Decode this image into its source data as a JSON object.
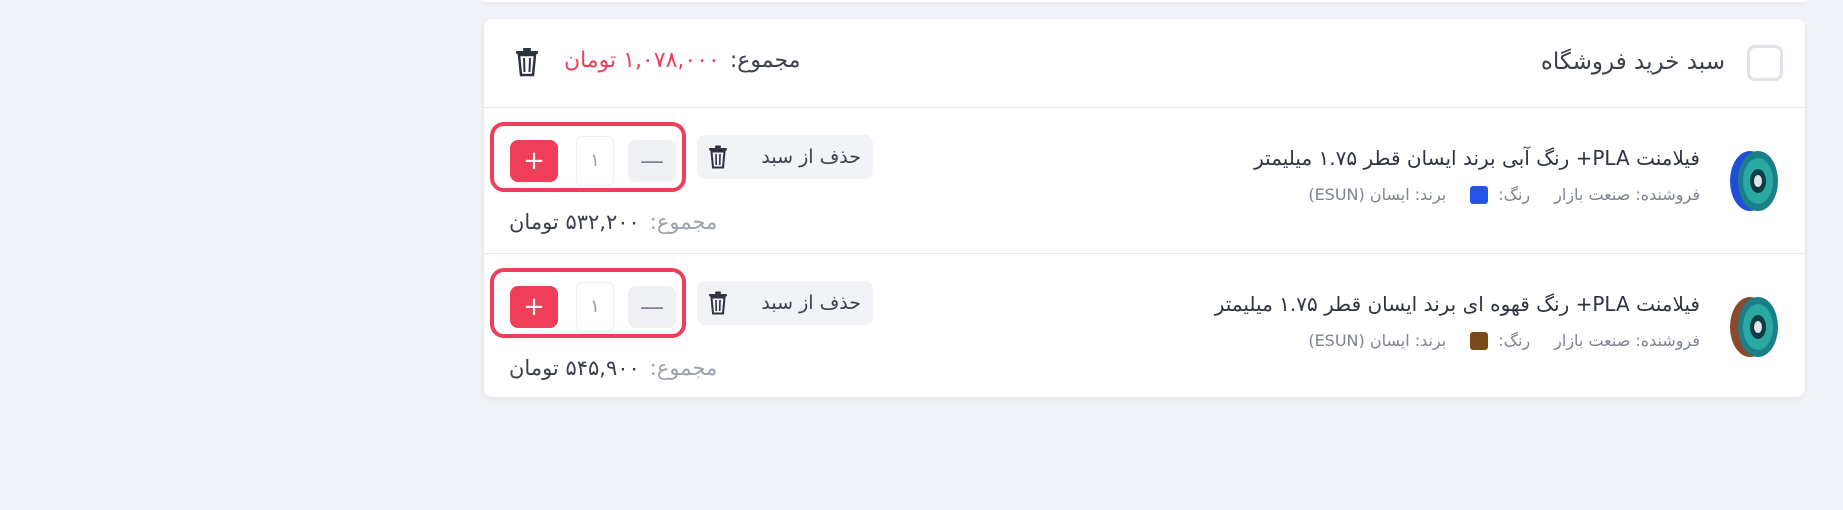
{
  "cart": {
    "title": "سبد خرید فروشگاه",
    "total_label": "مجموع:",
    "total_value": "۱,۰۷۸,۰۰۰ تومان"
  },
  "items": [
    {
      "title": "فیلامنت PLA+ رنگ آبی برند ایسان قطر ۱.۷۵ میلیمتر",
      "seller": "فروشنده: صنعت بازار",
      "color_label": "رنگ:",
      "color_hex": "#2354e6",
      "brand": "برند: ایسان (ESUN)",
      "remove_label": "حذف از سبد",
      "quantity": "۱",
      "plus": "+",
      "minus": "—",
      "total_label": "مجموع:",
      "total_value": "۵۳۲,۲۰۰ تومان",
      "spool_color": "#1f4fd8"
    },
    {
      "title": "فیلامنت PLA+ رنگ قهوه ای برند ایسان قطر ۱.۷۵ میلیمتر",
      "seller": "فروشنده: صنعت بازار",
      "color_label": "رنگ:",
      "color_hex": "#7a4a1c",
      "brand": "برند: ایسان (ESUN)",
      "remove_label": "حذف از سبد",
      "quantity": "۱",
      "plus": "+",
      "minus": "—",
      "total_label": "مجموع:",
      "total_value": "۵۴۵,۹۰۰ تومان",
      "spool_color": "#8a4a2c"
    }
  ],
  "colors": {
    "accent": "#ef3e5a",
    "background": "#f0f2f7"
  }
}
